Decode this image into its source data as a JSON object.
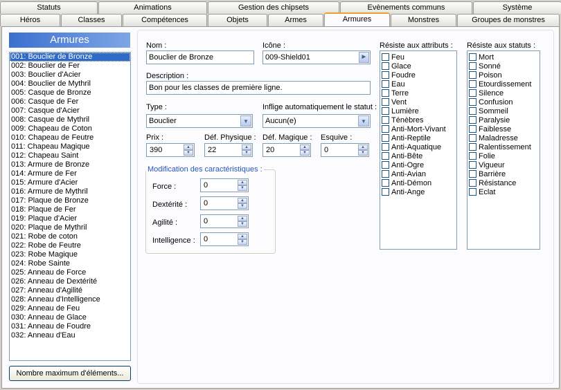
{
  "tabs_row1": [
    "Statuts",
    "Animations",
    "Gestion des chipsets",
    "Evènements communs",
    "Système"
  ],
  "tabs_row2": [
    "Héros",
    "Classes",
    "Compétences",
    "Objets",
    "Armes",
    "Armures",
    "Monstres",
    "Groupes de monstres"
  ],
  "list_title": "Armures",
  "items": [
    "001: Bouclier de Bronze",
    "002: Bouclier de Fer",
    "003: Bouclier d'Acier",
    "004: Bouclier de Mythril",
    "005: Casque de Bronze",
    "006: Casque de Fer",
    "007: Casque d'Acier",
    "008: Casque de Mythril",
    "009: Chapeau de Coton",
    "010: Chapeau de Feutre",
    "011: Chapeau Magique",
    "012: Chapeau Saint",
    "013: Armure de Bronze",
    "014: Armure de Fer",
    "015: Armure d'Acier",
    "016: Armure de Mythril",
    "017: Plaque de Bronze",
    "018: Plaque de Fer",
    "019: Plaque d'Acier",
    "020: Plaque de Mythril",
    "021: Robe de coton",
    "022: Robe de Feutre",
    "023: Robe Magique",
    "024: Robe Sainte",
    "025: Anneau de Force",
    "026: Anneau de Dextérité",
    "027: Anneau d'Agilité",
    "028: Anneau d'Intelligence",
    "029: Anneau de Feu",
    "030: Anneau de Glace",
    "031: Anneau de Foudre",
    "032: Anneau d'Eau"
  ],
  "max_button": "Nombre maximum d'éléments...",
  "form": {
    "name_label": "Nom :",
    "name_value": "Bouclier de Bronze",
    "icon_label": "Icône :",
    "icon_value": "009-Shield01",
    "desc_label": "Description :",
    "desc_value": "Bon pour les classes de première ligne.",
    "type_label": "Type :",
    "type_value": "Bouclier",
    "status_label": "Inflige automatiquement le statut :",
    "status_value": "Aucun(e)",
    "price_label": "Prix :",
    "price_value": "390",
    "pdef_label": "Déf. Physique :",
    "pdef_value": "22",
    "mdef_label": "Déf. Magique :",
    "mdef_value": "20",
    "eva_label": "Esquive :",
    "eva_value": "0"
  },
  "stats": {
    "legend": "Modification des caractéristiques :",
    "rows": [
      {
        "label": "Force :",
        "value": "0"
      },
      {
        "label": "Dextérité :",
        "value": "0"
      },
      {
        "label": "Agilité :",
        "value": "0"
      },
      {
        "label": "Intelligence :",
        "value": "0"
      }
    ]
  },
  "attributes": {
    "label": "Résiste aux attributs :",
    "items": [
      "Feu",
      "Glace",
      "Foudre",
      "Eau",
      "Terre",
      "Vent",
      "Lumière",
      "Ténèbres",
      "Anti-Mort-Vivant",
      "Anti-Reptile",
      "Anti-Aquatique",
      "Anti-Bête",
      "Anti-Ogre",
      "Anti-Avian",
      "Anti-Démon",
      "Anti-Ange"
    ]
  },
  "statuses": {
    "label": "Résiste aux statuts :",
    "items": [
      "Mort",
      "Sonné",
      "Poison",
      "Etourdissement",
      "Silence",
      "Confusion",
      "Sommeil",
      "Paralysie",
      "Faiblesse",
      "Maladresse",
      "Ralentissement",
      "Folie",
      "Vigueur",
      "Barrière",
      "Résistance",
      "Eclat"
    ]
  }
}
